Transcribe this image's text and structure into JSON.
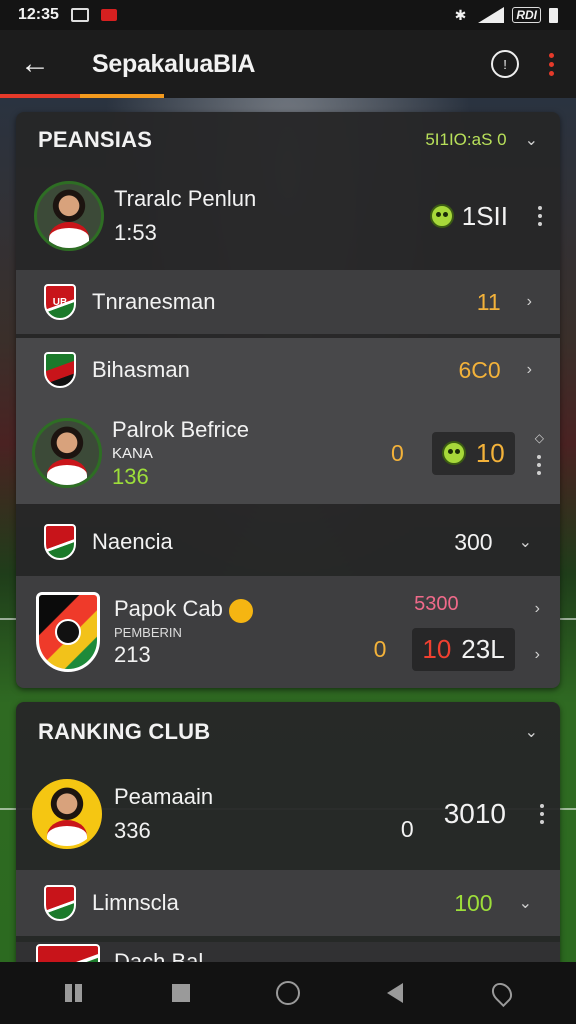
{
  "status_bar": {
    "time": "12:35",
    "battery_label": "RDI"
  },
  "app_bar": {
    "title": "SepakaluaBIA"
  },
  "colors": {
    "accent_red": "#e53a2a",
    "accent_orange": "#f39a1e",
    "green": "#9dde3a",
    "amber": "#f3b23a"
  },
  "cards": {
    "peansias": {
      "title": "PEANSIAS",
      "meta": "5I1IO:aS 0",
      "player": {
        "name": "Traralc Penlun",
        "sub": "1:53",
        "value": "1SII"
      }
    },
    "rows": [
      {
        "name": "Tnranesman",
        "value": "11"
      },
      {
        "name": "Bihasman",
        "value": "6C0"
      }
    ],
    "player2": {
      "name": "Palrok Befrice",
      "code": "KANA",
      "points": "136",
      "zero": "0",
      "score": "10"
    },
    "naencia": {
      "name": "Naencia",
      "value": "300"
    },
    "club": {
      "name": "Papok Cab",
      "sub_label": "PEMBERIN",
      "sub": "213",
      "pink_value": "5300",
      "zero": "0",
      "score_red": "10",
      "score_white": "23L"
    }
  },
  "ranking": {
    "title": "RANKING CLUB",
    "player": {
      "name": "Peamaain",
      "sub": "336",
      "zero": "0",
      "value": "3010"
    },
    "row": {
      "name": "Limnscla",
      "value": "100"
    },
    "partial": {
      "name": "Dach Bal"
    }
  }
}
